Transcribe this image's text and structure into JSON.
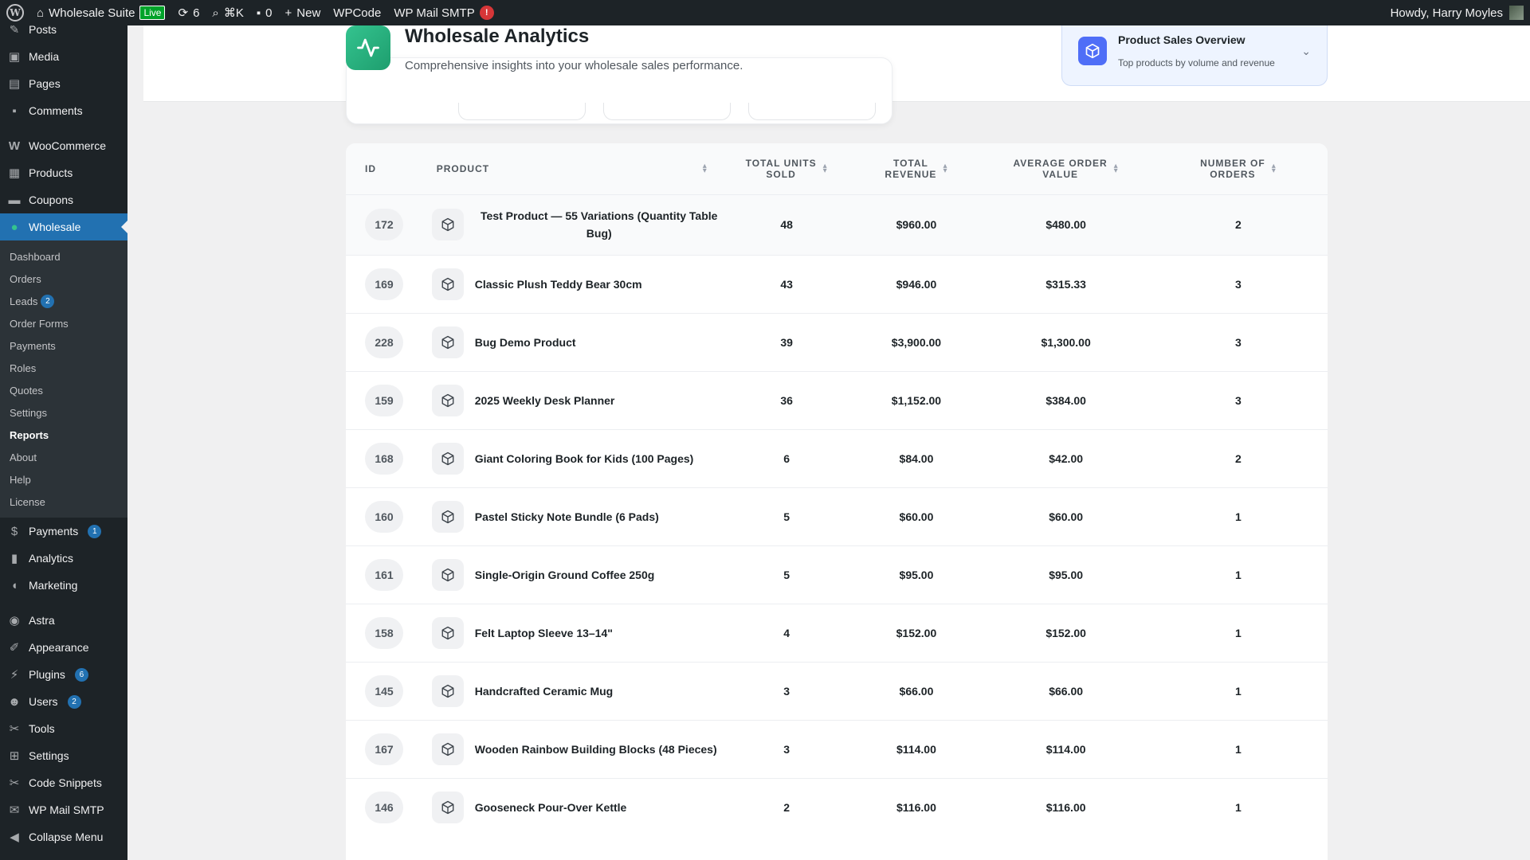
{
  "adminbar": {
    "site_name": "Wholesale Suite",
    "live_label": "Live",
    "updates_count": "6",
    "search_shortcut": "⌘K",
    "comments_count": "0",
    "new_label": "New",
    "wpcode_label": "WPCode",
    "smtp_label": "WP Mail SMTP",
    "smtp_badge": "!",
    "greeting": "Howdy, Harry Moyles"
  },
  "sidebar": {
    "items_top": [
      {
        "label": "Posts",
        "icon": "pin-icon"
      },
      {
        "label": "Media",
        "icon": "media-icon"
      },
      {
        "label": "Pages",
        "icon": "pages-icon"
      },
      {
        "label": "Comments",
        "icon": "comments-icon"
      }
    ],
    "items_shop": [
      {
        "label": "WooCommerce",
        "icon": "woo-icon"
      },
      {
        "label": "Products",
        "icon": "products-icon"
      },
      {
        "label": "Coupons",
        "icon": "coupons-icon"
      }
    ],
    "current": {
      "label": "Wholesale",
      "icon": "wholesale-icon"
    },
    "submenu": [
      {
        "label": "Dashboard"
      },
      {
        "label": "Orders"
      },
      {
        "label": "Leads",
        "badge": "2"
      },
      {
        "label": "Order Forms"
      },
      {
        "label": "Payments"
      },
      {
        "label": "Roles"
      },
      {
        "label": "Quotes"
      },
      {
        "label": "Settings"
      },
      {
        "label": "Reports",
        "active": true
      },
      {
        "label": "About"
      },
      {
        "label": "Help"
      },
      {
        "label": "License"
      }
    ],
    "items_mid": [
      {
        "label": "Payments",
        "icon": "payments-icon",
        "badge": "1"
      },
      {
        "label": "Analytics",
        "icon": "analytics-icon"
      },
      {
        "label": "Marketing",
        "icon": "marketing-icon"
      }
    ],
    "items_bottom": [
      {
        "label": "Astra",
        "icon": "astra-icon"
      },
      {
        "label": "Appearance",
        "icon": "appearance-icon"
      },
      {
        "label": "Plugins",
        "icon": "plugins-icon",
        "badge": "6"
      },
      {
        "label": "Users",
        "icon": "users-icon",
        "badge": "2"
      },
      {
        "label": "Tools",
        "icon": "tools-icon"
      },
      {
        "label": "Settings",
        "icon": "settings-icon"
      },
      {
        "label": "Code Snippets",
        "icon": "code-snippets-icon"
      },
      {
        "label": "WP Mail SMTP",
        "icon": "mail-icon"
      },
      {
        "label": "Collapse Menu",
        "icon": "collapse-icon"
      }
    ]
  },
  "header": {
    "title": "Wholesale Analytics",
    "subtitle": "Comprehensive insights into your wholesale sales performance."
  },
  "overview": {
    "title": "Product Sales Overview",
    "subtitle": "Top products by volume and revenue"
  },
  "table": {
    "columns": {
      "id": "ID",
      "product": "Product",
      "units_1": "Total Units",
      "units_2": "Sold",
      "revenue_1": "Total",
      "revenue_2": "Revenue",
      "aov_1": "Average Order",
      "aov_2": "Value",
      "orders_1": "Number of",
      "orders_2": "Orders"
    },
    "rows": [
      {
        "id": "172",
        "name": "Test Product — 55 Variations (Quantity Table Bug)",
        "units": "48",
        "revenue": "$960.00",
        "aov": "$480.00",
        "orders": "2"
      },
      {
        "id": "169",
        "name": "Classic Plush Teddy Bear 30cm",
        "units": "43",
        "revenue": "$946.00",
        "aov": "$315.33",
        "orders": "3"
      },
      {
        "id": "228",
        "name": "Bug Demo Product",
        "units": "39",
        "revenue": "$3,900.00",
        "aov": "$1,300.00",
        "orders": "3"
      },
      {
        "id": "159",
        "name": "2025 Weekly Desk Planner",
        "units": "36",
        "revenue": "$1,152.00",
        "aov": "$384.00",
        "orders": "3"
      },
      {
        "id": "168",
        "name": "Giant Coloring Book for Kids (100 Pages)",
        "units": "6",
        "revenue": "$84.00",
        "aov": "$42.00",
        "orders": "2"
      },
      {
        "id": "160",
        "name": "Pastel Sticky Note Bundle (6 Pads)",
        "units": "5",
        "revenue": "$60.00",
        "aov": "$60.00",
        "orders": "1"
      },
      {
        "id": "161",
        "name": "Single-Origin Ground Coffee 250g",
        "units": "5",
        "revenue": "$95.00",
        "aov": "$95.00",
        "orders": "1"
      },
      {
        "id": "158",
        "name": "Felt Laptop Sleeve 13–14\"",
        "units": "4",
        "revenue": "$152.00",
        "aov": "$152.00",
        "orders": "1"
      },
      {
        "id": "145",
        "name": "Handcrafted Ceramic Mug",
        "units": "3",
        "revenue": "$66.00",
        "aov": "$66.00",
        "orders": "1"
      },
      {
        "id": "167",
        "name": "Wooden Rainbow Building Blocks (48 Pieces)",
        "units": "3",
        "revenue": "$114.00",
        "aov": "$114.00",
        "orders": "1"
      },
      {
        "id": "146",
        "name": "Gooseneck Pour-Over Kettle",
        "units": "2",
        "revenue": "$116.00",
        "aov": "$116.00",
        "orders": "1"
      }
    ]
  },
  "colors": {
    "accent": "#2271b1",
    "analytics_green": "#1e9e6e",
    "overview_blue": "#4f6ef7"
  }
}
